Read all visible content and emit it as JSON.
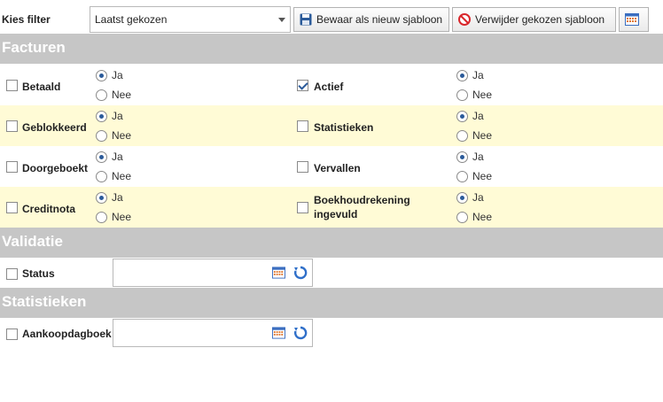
{
  "toolbar": {
    "filter_label": "Kies filter",
    "filter_value": "Laatst gekozen",
    "save_label": "Bewaar als nieuw sjabloon",
    "delete_label": "Verwijder gekozen sjabloon"
  },
  "sections": {
    "facturen": "Facturen",
    "validatie": "Validatie",
    "statistieken": "Statistieken"
  },
  "radio_labels": {
    "yes": "Ja",
    "no": "Nee"
  },
  "facturen_rows": [
    {
      "left": {
        "label": "Betaald",
        "checked": false,
        "value": "Ja"
      },
      "right": {
        "label": "Actief",
        "checked": true,
        "value": "Ja"
      }
    },
    {
      "left": {
        "label": "Geblokkeerd",
        "checked": false,
        "value": "Ja"
      },
      "right": {
        "label": "Statistieken",
        "checked": false,
        "value": "Ja"
      }
    },
    {
      "left": {
        "label": "Doorgeboekt",
        "checked": false,
        "value": "Ja"
      },
      "right": {
        "label": "Vervallen",
        "checked": false,
        "value": "Ja"
      }
    },
    {
      "left": {
        "label": "Creditnota",
        "checked": false,
        "value": "Ja"
      },
      "right": {
        "label": "Boekhoudrekening ingevuld",
        "checked": false,
        "value": "Ja"
      }
    }
  ],
  "validatie": {
    "status_label": "Status",
    "status_value": ""
  },
  "statistieken": {
    "aankoopdagboek_label": "Aankoopdagboek",
    "aankoopdagboek_value": ""
  },
  "colors": {
    "section_header": "#c6c6c6",
    "alt_row": "#fffbd6",
    "accent": "#2b5b9a"
  }
}
